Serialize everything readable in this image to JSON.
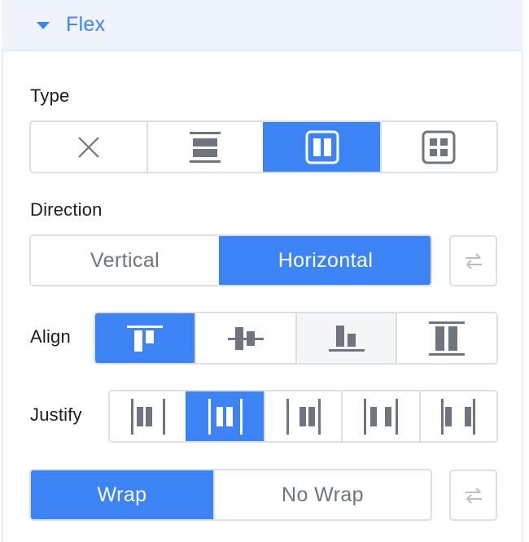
{
  "section": {
    "title": "Flex",
    "icon": "caret-down-icon"
  },
  "type": {
    "label": "Type",
    "options": [
      {
        "name": "none",
        "icon": "x-icon",
        "active": false
      },
      {
        "name": "block-stack",
        "icon": "stack-rows-icon",
        "active": false
      },
      {
        "name": "flex",
        "icon": "flex-columns-icon",
        "active": true
      },
      {
        "name": "grid",
        "icon": "grid-icon",
        "active": false
      }
    ]
  },
  "direction": {
    "label": "Direction",
    "options": [
      {
        "label": "Vertical",
        "active": false
      },
      {
        "label": "Horizontal",
        "active": true
      }
    ],
    "reverse_icon": "swap-arrows-icon"
  },
  "align": {
    "label": "Align",
    "options": [
      {
        "name": "start",
        "icon": "align-start-icon",
        "active": true
      },
      {
        "name": "center",
        "icon": "align-center-icon",
        "active": false
      },
      {
        "name": "end",
        "icon": "align-end-icon",
        "active": false
      },
      {
        "name": "stretch",
        "icon": "align-stretch-icon",
        "active": false
      }
    ]
  },
  "justify": {
    "label": "Justify",
    "options": [
      {
        "name": "start",
        "icon": "justify-start-icon",
        "active": false
      },
      {
        "name": "center",
        "icon": "justify-center-icon",
        "active": true
      },
      {
        "name": "end",
        "icon": "justify-end-icon",
        "active": false
      },
      {
        "name": "space-between",
        "icon": "justify-space-between-icon",
        "active": false
      },
      {
        "name": "space-around",
        "icon": "justify-space-around-icon",
        "active": false
      }
    ]
  },
  "wrap": {
    "options": [
      {
        "label": "Wrap",
        "active": true
      },
      {
        "label": "No Wrap",
        "active": false
      }
    ],
    "reverse_icon": "swap-arrows-icon"
  },
  "colors": {
    "accent": "#3c84f5",
    "icon_gray": "#6f757f",
    "border": "#dcdfe6",
    "header_bg": "#eef3fc"
  }
}
